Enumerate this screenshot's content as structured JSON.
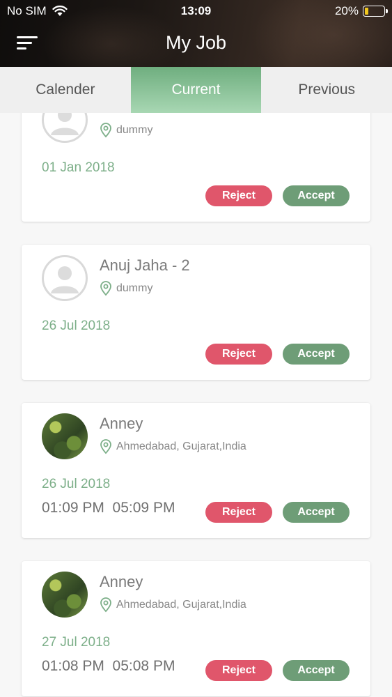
{
  "status_bar": {
    "carrier": "No SIM",
    "time": "13:09",
    "battery_percent": "20%",
    "battery_level": 0.2,
    "battery_color": "#f2c81f"
  },
  "header": {
    "title": "My Job",
    "menu_icon": "hamburger-menu-icon"
  },
  "tabs": [
    {
      "label": "Calender",
      "active": false
    },
    {
      "label": "Current",
      "active": true
    },
    {
      "label": "Previous",
      "active": false
    }
  ],
  "colors": {
    "accent_green": "#6e9d77",
    "reject_red": "#e0566b",
    "date_green": "#7daf89"
  },
  "jobs": [
    {
      "name": "",
      "location": "dummy",
      "date": "01 Jan 2018",
      "times": "",
      "avatar": "placeholder-avatar-icon",
      "reject_label": "Reject",
      "accept_label": "Accept"
    },
    {
      "name": "Anuj Jaha - 2",
      "location": "dummy",
      "date": "26 Jul 2018",
      "times": "",
      "avatar": "placeholder-avatar-icon",
      "reject_label": "Reject",
      "accept_label": "Accept"
    },
    {
      "name": "Anney",
      "location": "Ahmedabad, Gujarat,India",
      "date": "26 Jul 2018",
      "times": "01:09 PM  05:09 PM",
      "avatar": "photo",
      "reject_label": "Reject",
      "accept_label": "Accept"
    },
    {
      "name": "Anney",
      "location": "Ahmedabad, Gujarat,India",
      "date": "27 Jul 2018",
      "times": "01:08 PM  05:08 PM",
      "avatar": "photo",
      "reject_label": "Reject",
      "accept_label": "Accept"
    }
  ]
}
